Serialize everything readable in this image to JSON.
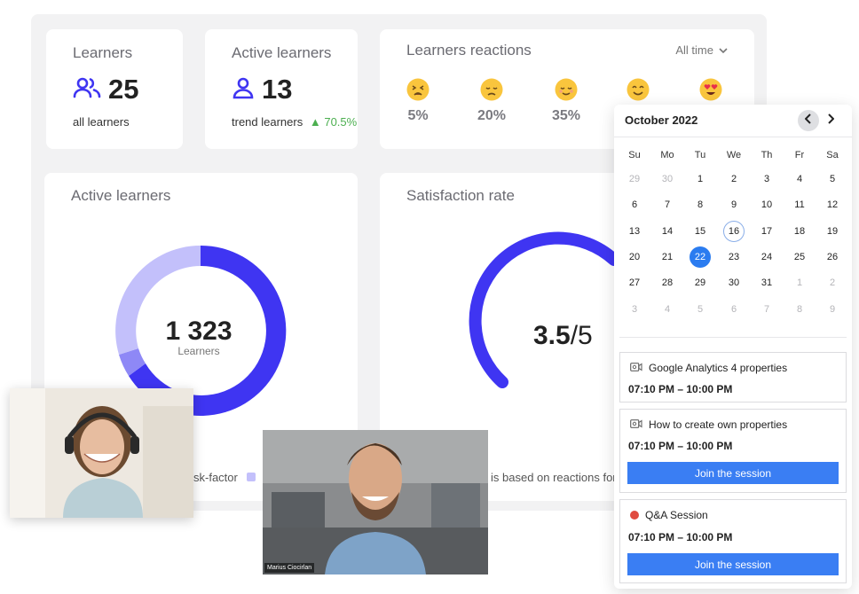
{
  "stats": {
    "learners": {
      "title": "Learners",
      "value": "25",
      "sub": "all learners",
      "icon": "users-icon"
    },
    "active": {
      "title": "Active learners",
      "value": "13",
      "sub": "trend learners",
      "trend": "70.5%",
      "icon": "user-icon"
    }
  },
  "reactions": {
    "title": "Learners reactions",
    "filter": "All time",
    "items": [
      {
        "emoji": "tired-face-icon",
        "pct": "5%"
      },
      {
        "emoji": "disappointed-face-icon",
        "pct": "20%"
      },
      {
        "emoji": "relieved-face-icon",
        "pct": "35%"
      },
      {
        "emoji": "smiling-face-icon",
        "pct": ""
      },
      {
        "emoji": "heart-eyes-face-icon",
        "pct": ""
      }
    ]
  },
  "active_chart": {
    "title": "Active learners",
    "center_value": "1 323",
    "center_label": "Learners",
    "legend_fragment": "sk-factor",
    "colors": {
      "primary": "#3f35f2",
      "secondary": "#c3c0fb",
      "tertiary": "#8e88f6"
    }
  },
  "satisfaction": {
    "title": "Satisfaction rate",
    "score": "3.5",
    "max": "/5",
    "note_fragment": "is based on reactions for a",
    "color": "#3f35f2"
  },
  "calendar": {
    "month": "October 2022",
    "weekdays": [
      "Su",
      "Mo",
      "Tu",
      "We",
      "Th",
      "Fr",
      "Sa"
    ],
    "weeks": [
      [
        "29",
        "30",
        "1",
        "2",
        "3",
        "4",
        "5"
      ],
      [
        "6",
        "7",
        "8",
        "9",
        "10",
        "11",
        "12"
      ],
      [
        "13",
        "14",
        "15",
        "16",
        "17",
        "18",
        "19"
      ],
      [
        "20",
        "21",
        "22",
        "23",
        "24",
        "25",
        "26"
      ],
      [
        "27",
        "28",
        "29",
        "30",
        "31",
        "1",
        "2"
      ],
      [
        "3",
        "4",
        "5",
        "6",
        "7",
        "8",
        "9"
      ]
    ],
    "today": "16",
    "selected": "22",
    "accent": "#2b7cf0"
  },
  "sessions": [
    {
      "title": "Google Analytics 4 properties",
      "time": "07:10 PM – 10:00 PM",
      "icon": "video-camera-icon"
    },
    {
      "title": "How to create own properties",
      "time": "07:10 PM – 10:00 PM",
      "icon": "video-camera-icon",
      "button": "Join the session"
    },
    {
      "title": "Q&A Session",
      "time": "07:10 PM – 10:00 PM",
      "icon": "live-dot-icon",
      "button": "Join the session"
    }
  ],
  "videos": {
    "second_name": "Marius Ciocirlan"
  }
}
